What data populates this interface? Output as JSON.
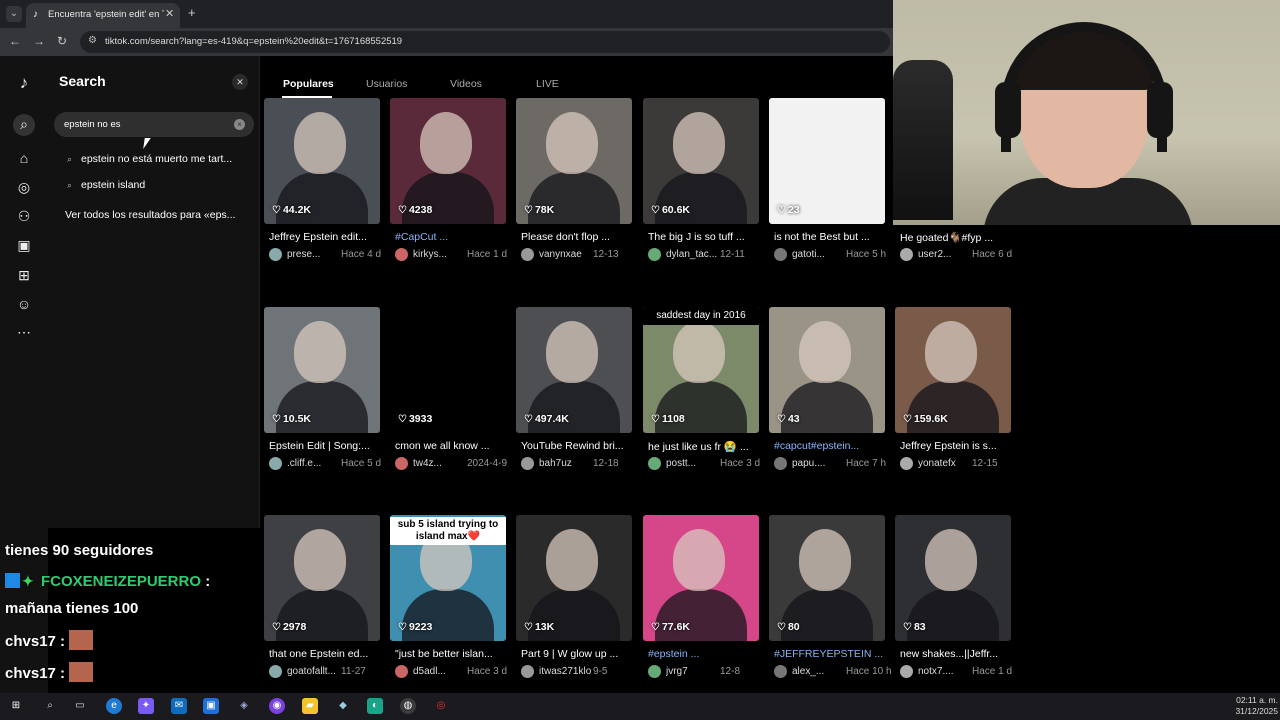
{
  "browser": {
    "tab_title": "Encuentra 'epstein edit' en TikTok",
    "url": "tiktok.com/search?lang=es-419&q=epstein%20edit&t=1767168552519"
  },
  "search_panel": {
    "title": "Search",
    "query": "epstein no es",
    "suggestions": [
      "epstein no está muerto me tart...",
      "epstein island"
    ],
    "see_all": "Ver todos los resultados para «eps..."
  },
  "results_tabs": [
    "Populares",
    "Usuarios",
    "Videos",
    "LIVE"
  ],
  "videos": [
    {
      "likes": "44.2K",
      "caption": "Jeffrey Epstein edit...",
      "user": "prese...",
      "date": "Hace 4 d",
      "thumb": "#4a4f55",
      "tag": false
    },
    {
      "likes": "4238",
      "caption": "#CapCut ...",
      "user": "kirkys...",
      "date": "Hace 1 d",
      "thumb": "#5a2a3a",
      "tag": true
    },
    {
      "likes": "78K",
      "caption": "Please don't flop ...",
      "user": "vanynxae",
      "date": "12-13",
      "thumb": "#6d6a66",
      "tag": false
    },
    {
      "likes": "60.6K",
      "caption": "The big J is so tuff ...",
      "user": "dylan_tac...",
      "date": "12-11",
      "thumb": "#3c3a39",
      "tag": false
    },
    {
      "likes": "23",
      "caption": "is not the Best but ...",
      "user": "gatoti...",
      "date": "Hace 5 h",
      "thumb": "#f2f2f2",
      "tag": false
    },
    {
      "likes": "",
      "caption": "He goated🐐#fyp ...",
      "user": "user2...",
      "date": "Hace 6 d",
      "thumb": "#000000",
      "tag": false
    },
    {
      "likes": "10.5K",
      "caption": "Epstein Edit | Song:...",
      "user": ".cliff.e...",
      "date": "Hace 5 d",
      "thumb": "#6e7478",
      "tag": false
    },
    {
      "likes": "3933",
      "caption": "cmon we all know ...",
      "user": "tw4z...",
      "date": "2024-4-9",
      "thumb": "#000000",
      "tag": false
    },
    {
      "likes": "497.4K",
      "caption": "YouTube Rewind bri...",
      "user": "bah7uz",
      "date": "12-18",
      "thumb": "#4d4f52",
      "tag": false
    },
    {
      "likes": "1108",
      "caption": "he just like us fr 😭 ...",
      "user": "postt...",
      "date": "Hace 3 d",
      "thumb": "#7c8a6a",
      "tag": false,
      "overlay": "saddest day in 2016"
    },
    {
      "likes": "43",
      "caption": "#capcut#epstein...",
      "user": "papu....",
      "date": "Hace 7 h",
      "thumb": "#9a9486",
      "tag": true
    },
    {
      "likes": "159.6K",
      "caption": "Jeffrey Epstein is s...",
      "user": "yonatefx",
      "date": "12-15",
      "thumb": "#7a5a48",
      "tag": false
    },
    {
      "likes": "2978",
      "caption": "that one Epstein ed...",
      "user": "goatofallt...",
      "date": "11-27",
      "thumb": "#3f4043",
      "tag": false
    },
    {
      "likes": "9223",
      "caption": "\"just be better islan...",
      "user": "d5adl...",
      "date": "Hace 3 d",
      "thumb": "#3f8fb0",
      "tag": false,
      "overlay": "sub 5 island trying to island max❤️"
    },
    {
      "likes": "13K",
      "caption": "Part 9 | W glow up ...",
      "user": "itwas271klol",
      "date": "9-5",
      "thumb": "#2a2a2a",
      "tag": false
    },
    {
      "likes": "77.6K",
      "caption": "#epstein ...",
      "user": "jvrg7",
      "date": "12-8",
      "thumb": "#d6478a",
      "tag": true
    },
    {
      "likes": "80",
      "caption": "#JEFFREYEPSTEIN ...",
      "user": "alex_...",
      "date": "Hace 10 h",
      "thumb": "#3a3a3a",
      "tag": true
    },
    {
      "likes": "83",
      "caption": "new shakes...||Jeffr...",
      "user": "notx7....",
      "date": "Hace 1 d",
      "thumb": "#2d2f33",
      "tag": false
    }
  ],
  "chat": {
    "line1": "tienes 90 seguidores",
    "user1": "FCOXENEIZEPUERRO",
    "line2": "mañana tienes 100",
    "user2": "chvs17",
    "colon": ":"
  },
  "taskbar": {
    "time": "02:11 a. m.",
    "date": "31/12/2025"
  }
}
